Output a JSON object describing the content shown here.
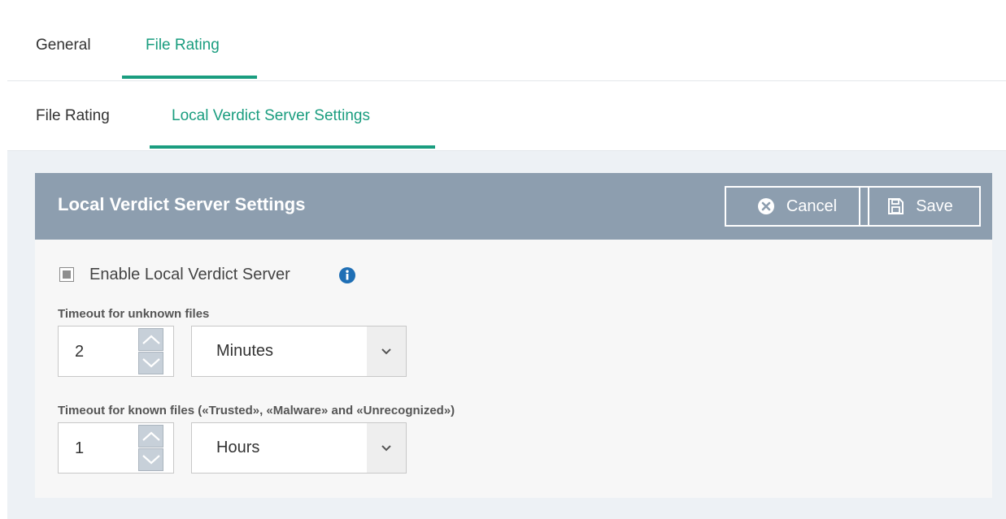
{
  "top_tabs": [
    {
      "label": "General",
      "active": false
    },
    {
      "label": "File Rating",
      "active": true
    }
  ],
  "sub_tabs": [
    {
      "label": "File Rating",
      "active": false
    },
    {
      "label": "Local Verdict Server Settings",
      "active": true
    }
  ],
  "panel": {
    "title": "Local Verdict Server Settings",
    "cancel_label": "Cancel",
    "save_label": "Save",
    "cancel_icon": "close-circle-icon",
    "save_icon": "floppy-disk-icon"
  },
  "enable_server": {
    "label": "Enable Local Verdict Server",
    "info_icon": "info-icon"
  },
  "unknown_timeout": {
    "title": "Timeout for unknown files",
    "value": "2",
    "unit": "Minutes"
  },
  "known_timeout": {
    "title": "Timeout for known files («Trusted», «Malware» and «Unrecognized»)",
    "value": "1",
    "unit": "Hours"
  },
  "colors": {
    "accent": "#1a9d7f",
    "header": "#8d9eaf"
  }
}
